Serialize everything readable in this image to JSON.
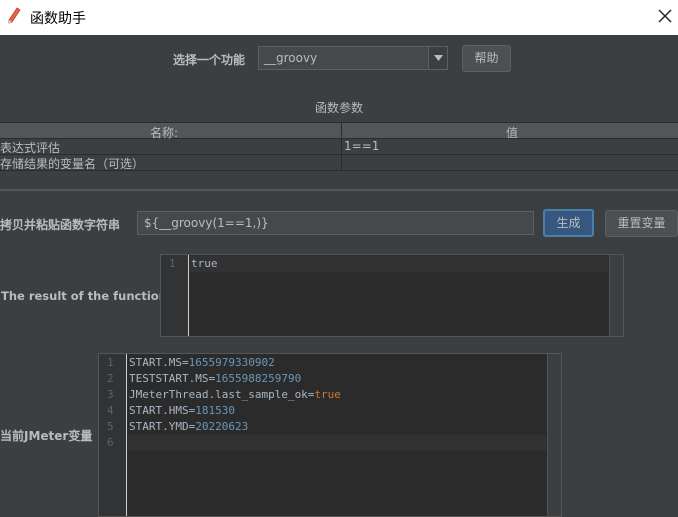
{
  "window": {
    "title": "函数助手"
  },
  "top": {
    "function_label": "选择一个功能",
    "selected_function": "__groovy",
    "help_button": "帮助"
  },
  "params": {
    "section_title": "函数参数",
    "col_name": "名称:",
    "col_value": "值",
    "rows": [
      {
        "name": "表达式评估",
        "value": "1==1"
      },
      {
        "name": "存储结果的变量名（可选）",
        "value": ""
      }
    ]
  },
  "copy": {
    "label": "拷贝并粘贴函数字符串",
    "value": "${__groovy(1==1,)}",
    "generate_button": "生成",
    "reset_button": "重置变量"
  },
  "result": {
    "label": "The result of the function is",
    "lines": [
      {
        "num": "1",
        "text": "true"
      }
    ]
  },
  "vars": {
    "label": "当前JMeter变量",
    "lines": [
      {
        "num": "1",
        "key": "START.MS=",
        "val": "1655979330902"
      },
      {
        "num": "2",
        "key": "TESTSTART.MS=",
        "val": "1655988259790"
      },
      {
        "num": "3",
        "key": "JMeterThread.last_sample_ok=",
        "val": "true"
      },
      {
        "num": "4",
        "key": "START.HMS=",
        "val": "181530"
      },
      {
        "num": "5",
        "key": "START.YMD=",
        "val": "20220623"
      },
      {
        "num": "6",
        "key": "",
        "val": ""
      }
    ]
  },
  "icons": {
    "app": "pencil-icon",
    "close": "close-icon",
    "dropdown": "chevron-down-icon"
  }
}
